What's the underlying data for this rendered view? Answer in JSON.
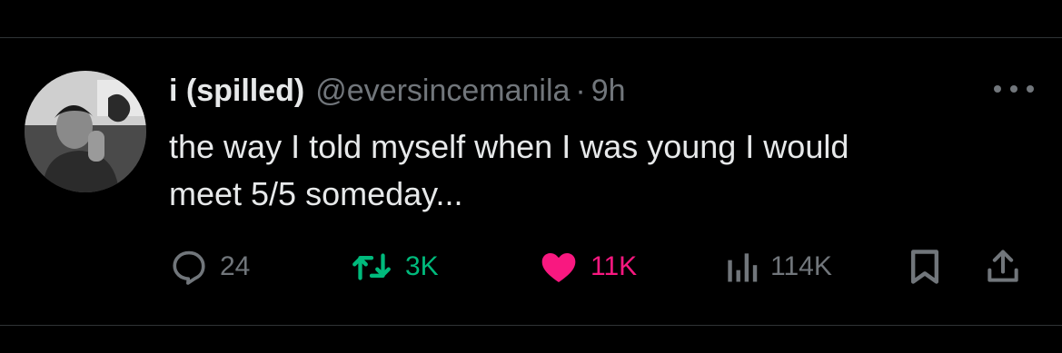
{
  "post": {
    "author_name": "i (spilled)",
    "handle": "@eversincemanila",
    "separator": "·",
    "time": "9h",
    "text": "the way I told myself when I was young I would\nmeet 5/5 someday..."
  },
  "actions": {
    "replies": "24",
    "reposts": "3K",
    "likes": "11K",
    "views": "114K"
  },
  "colors": {
    "background": "#000000",
    "text": "#e7e9ea",
    "muted": "#71767b",
    "repost_accent": "#00ba7c",
    "like_accent": "#f91880",
    "divider": "#2f3336"
  },
  "icons": [
    "avatar",
    "more-icon",
    "reply-icon",
    "repost-icon",
    "like-icon",
    "views-icon",
    "bookmark-icon",
    "share-icon"
  ]
}
